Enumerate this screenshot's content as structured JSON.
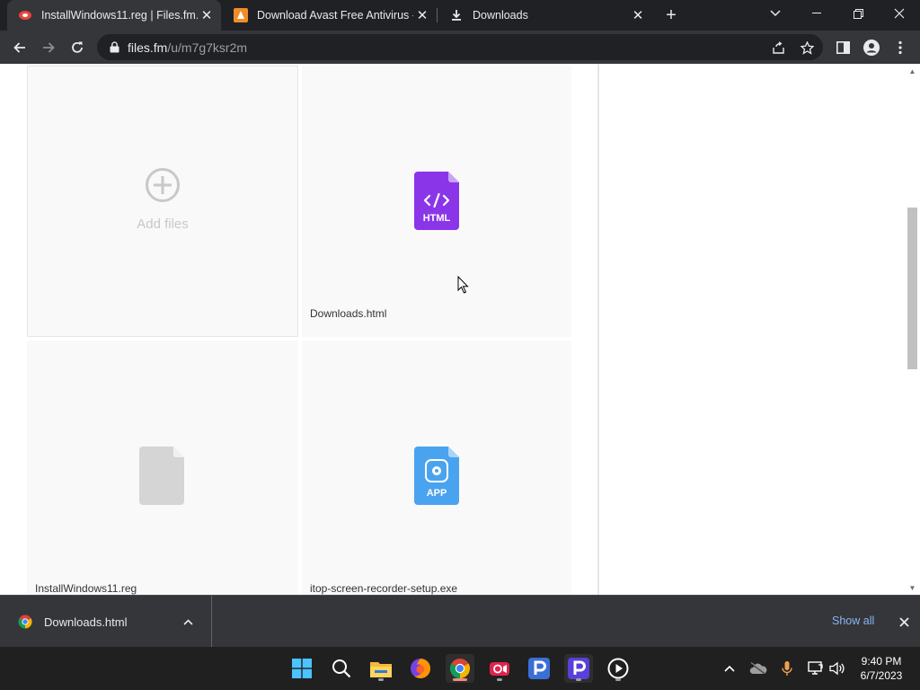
{
  "browser": {
    "tabs": [
      {
        "title": "InstallWindows11.reg | Files.fm."
      },
      {
        "title": "Download Avast Free Antivirus - ("
      },
      {
        "title": "Downloads"
      }
    ],
    "new_tab_label": "+",
    "url_host": "files.fm",
    "url_path": "/u/m7g7ksr2m"
  },
  "page": {
    "add_files_label": "Add files",
    "files": [
      {
        "name": "Downloads.html",
        "icon": "html-file-icon",
        "icon_text": "HTML",
        "icon_color": "#8b35e8"
      },
      {
        "name": "InstallWindows11.reg",
        "icon": "generic-file-icon",
        "icon_text": "",
        "icon_color": "#d5d5d5"
      },
      {
        "name": "itop-screen-recorder-setup.exe",
        "icon": "app-file-icon",
        "icon_text": "APP",
        "icon_color": "#4aa3ef"
      }
    ]
  },
  "download_shelf": {
    "item_name": "Downloads.html",
    "show_all_label": "Show all"
  },
  "taskbar": {
    "time": "9:40 PM",
    "date": "6/7/2023"
  },
  "colors": {
    "accent_link": "#8ab4f8",
    "chrome_dark": "#202124",
    "chrome_toolbar": "#35363a"
  }
}
